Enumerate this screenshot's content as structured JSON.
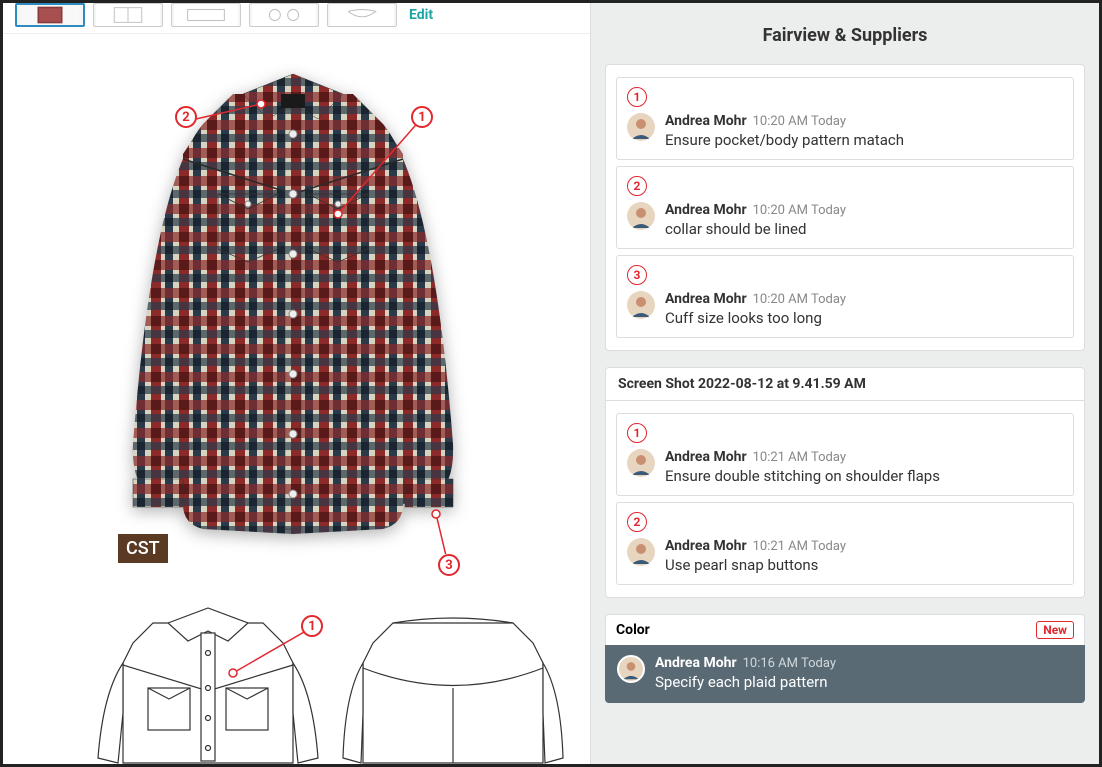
{
  "left": {
    "edit_label": "Edit",
    "cst_tag": "CST",
    "markers": [
      "1",
      "2",
      "3"
    ],
    "tech_marker": "1"
  },
  "right": {
    "title": "Fairview & Suppliers",
    "group1": {
      "comments": [
        {
          "num": "1",
          "author": "Andrea Mohr",
          "time": "10:20 AM Today",
          "msg": "Ensure pocket/body pattern matach"
        },
        {
          "num": "2",
          "author": "Andrea Mohr",
          "time": "10:20 AM Today",
          "msg": "collar should be lined"
        },
        {
          "num": "3",
          "author": "Andrea Mohr",
          "time": "10:20 AM Today",
          "msg": "Cuff size looks too long"
        }
      ]
    },
    "group2": {
      "header": "Screen Shot 2022-08-12 at 9.41.59 AM",
      "comments": [
        {
          "num": "1",
          "author": "Andrea Mohr",
          "time": "10:21 AM Today",
          "msg": "Ensure double stitching on shoulder flaps"
        },
        {
          "num": "2",
          "author": "Andrea Mohr",
          "time": "10:21 AM Today",
          "msg": "Use pearl snap buttons"
        }
      ]
    },
    "group3": {
      "header": "Color",
      "badge": "New",
      "comment": {
        "author": "Andrea Mohr",
        "time": "10:16 AM Today",
        "msg": "Specify each plaid pattern"
      }
    }
  }
}
